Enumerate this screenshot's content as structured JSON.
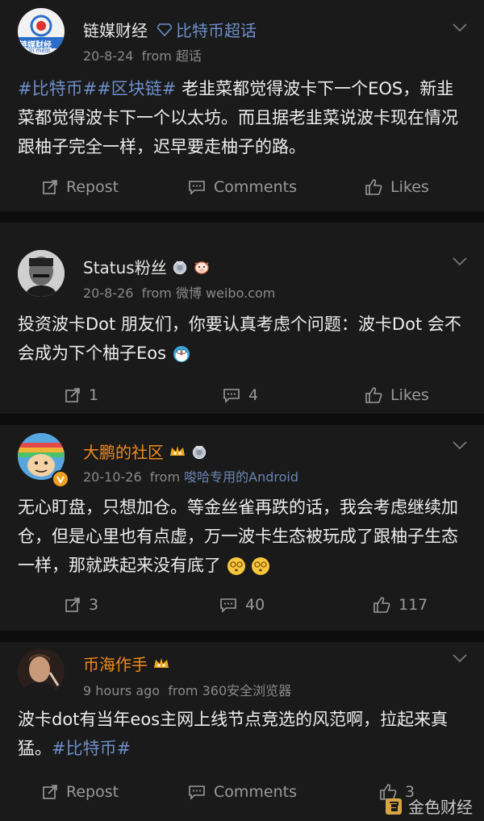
{
  "posts": [
    {
      "name": "链媒财经",
      "topic": "比特币超话",
      "date": "20-8-24",
      "from_label": "from",
      "source": "超话",
      "avatar_text": "链媒财经",
      "avatar_sub": "in medi",
      "body_tag1": "#比特币#",
      "body_tag2": "#区块链#",
      "body_text": " 老韭菜都觉得波卡下一个EOS，新韭菜都觉得波卡下一个以太坊。而且据老韭菜说波卡现在情况跟柚子完全一样，迟早要走柚子的路。",
      "repost": "Repost",
      "comments": "Comments",
      "likes": "Likes"
    },
    {
      "name": "Status粉丝",
      "date": "20-8-26",
      "from_label": "from",
      "source": "微博 weibo.com",
      "body_text": "投资波卡Dot 朋友们，你要认真考虑个问题：波卡Dot 会不会成为下个柚子Eos",
      "repost": "1",
      "comments": "4",
      "likes": "Likes"
    },
    {
      "name": "大鹏的社区",
      "date": "20-10-26",
      "from_label": "from",
      "source": "唆哈专用的Android",
      "body_text": "无心盯盘，只想加仓。等金丝雀再跌的话，我会考虑继续加仓，但是心里也有点虚，万一波卡生态被玩成了跟柚子生态一样，那就跌起来没有底了",
      "repost": "3",
      "comments": "40",
      "likes": "117"
    },
    {
      "name": "币海作手",
      "date": "9 hours ago",
      "from_label": "from",
      "source": "360安全浏览器",
      "body_text": "波卡dot有当年eos主网上线节点竞选的风范啊，拉起来真猛。",
      "body_tag_end": "#比特币#",
      "repost": "Repost",
      "comments": "Comments",
      "likes": "3"
    }
  ],
  "watermark": "金色财经",
  "colors": {
    "background": "#1a1a1a",
    "separator": "#0d0d0d",
    "link": "#6d8ec9",
    "vip_name": "#f08a1e"
  }
}
